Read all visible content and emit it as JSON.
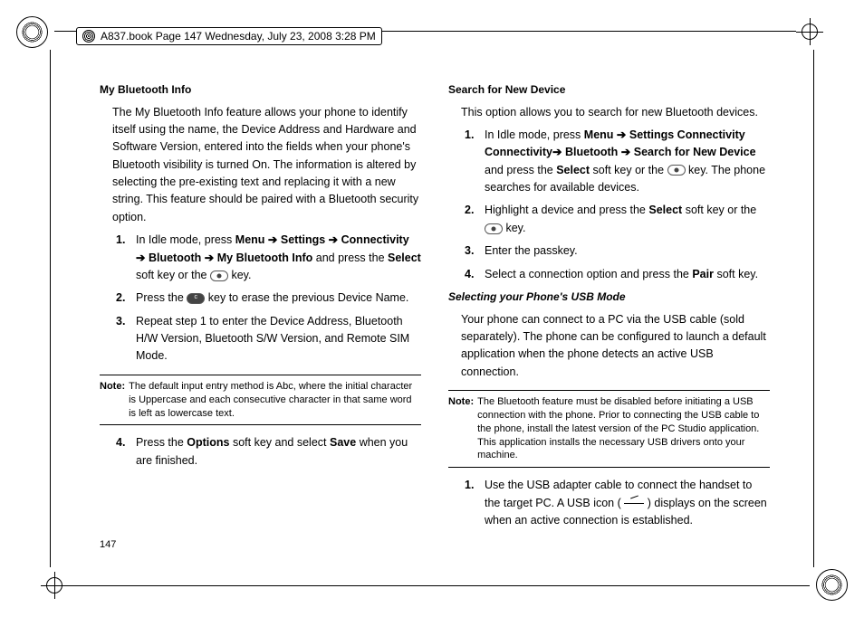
{
  "meta": {
    "crop_label": "A837.book  Page 147  Wednesday, July 23, 2008  3:28 PM"
  },
  "page_number": "147",
  "left": {
    "h1": "My Bluetooth Info",
    "intro": "The My Bluetooth Info feature allows your phone to identify itself using the name, the Device Address and Hardware and Software Version, entered into the fields when your phone's Bluetooth visibility is turned On. The information is altered by selecting the pre-existing text and replacing it with a new string. This feature should be paired with a Bluetooth security option.",
    "steps": {
      "s1a": "In Idle mode, press ",
      "s1_menu": "Menu",
      "arr": "➔",
      "s1_settings": "Settings",
      "s1_conn": "Connectivity",
      "s1_bt": "Bluetooth",
      "s1_mbi": "My Bluetooth Info",
      "s1b": " and press the ",
      "s1_select": "Select",
      "s1c": " soft key or the ",
      "s1d": " key.",
      "s2a": "Press the ",
      "s2b": " key to erase the previous Device Name.",
      "s3": "Repeat step 1 to enter the Device Address, Bluetooth H/W Version, Bluetooth S/W Version, and Remote SIM Mode.",
      "s4a": "Press the ",
      "s4_opt": "Options",
      "s4b": " soft key and select ",
      "s4_save": "Save",
      "s4c": " when you are finished."
    },
    "note_label": "Note:",
    "note": "The default input entry method is Abc, where the initial character is Uppercase and each consecutive character in that same word is left as lowercase text."
  },
  "right": {
    "h1": "Search for New Device",
    "intro": "This option allows you to search for new Bluetooth devices.",
    "steps": {
      "s1a": "In Idle mode, press ",
      "s1_menu": "Menu",
      "arr": "➔",
      "s1_settings": "Settings",
      "s1_conn": "Connectivity",
      "s1_bt": "Bluetooth",
      "s1_sfnd": "Search for New Device",
      "s1b": " and press the ",
      "s1_select": "Select",
      "s1c": " soft key or the ",
      "s1d": " key. The phone searches for available devices.",
      "s2a": "Highlight a device and press the ",
      "s2_select": "Select",
      "s2b": " soft key or the ",
      "s2c": " key.",
      "s3": "Enter the passkey.",
      "s4a": "Select a connection option and press the ",
      "s4_pair": "Pair",
      "s4b": " soft key."
    },
    "h2": "Selecting your Phone's USB Mode",
    "usb_intro": "Your phone can connect to a PC via the USB cable (sold separately). The phone can be configured to launch a default application when the phone detects an active USB connection.",
    "note_label": "Note:",
    "note": "The Bluetooth feature must be disabled before initiating a USB connection with the phone. Prior to connecting the USB cable to the phone, install the latest version of the PC Studio application. This application installs the necessary USB drivers onto your machine.",
    "usb_step1a": "Use the USB adapter cable to connect the handset to the target PC. A USB icon (",
    "usb_step1b": ") displays on the screen when an active connection is established."
  }
}
